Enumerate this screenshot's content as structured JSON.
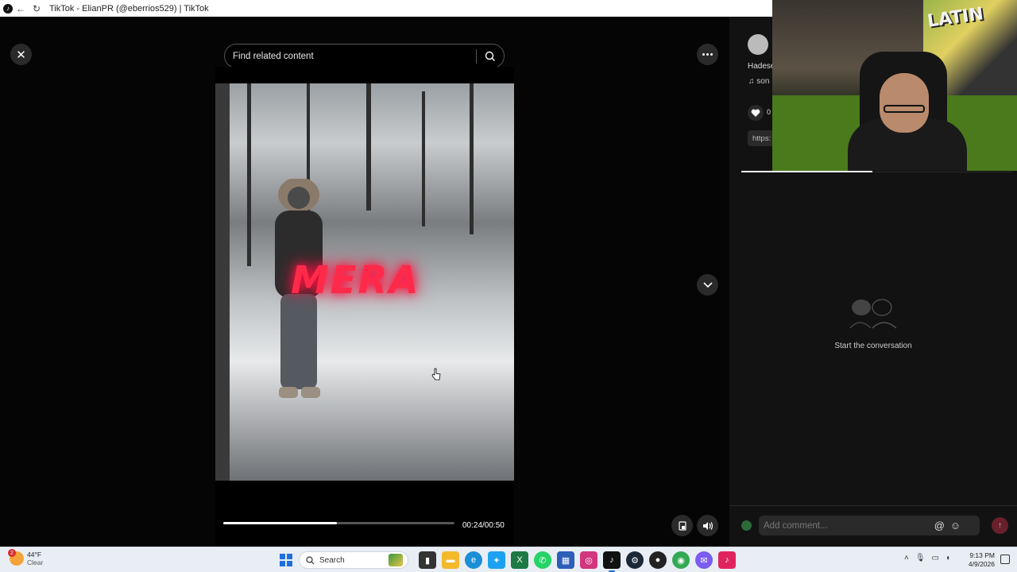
{
  "window": {
    "title": "TikTok - ElianPR (@eberrios529) | TikTok"
  },
  "viewer": {
    "search_placeholder": "Find related content",
    "overlay_text": "MERA",
    "time_display": "00:24/00:50",
    "progress_fraction": 0.49
  },
  "sidebar": {
    "author_name": "Hadese",
    "music_label": "son",
    "like_count": "0",
    "link_text": "https:",
    "empty_comments": "Start the conversation",
    "comment_placeholder": "Add comment...",
    "at_symbol": "@"
  },
  "webcam": {
    "graffiti": "LATIN"
  },
  "taskbar": {
    "weather_temp": "44°F",
    "weather_desc": "Clear",
    "weather_badge": "2",
    "search_label": "Search",
    "time": "9:13 PM",
    "date": "4/9/2026",
    "apps": [
      "file-manager",
      "edge",
      "twitter",
      "excel",
      "whatsapp",
      "store",
      "instagram",
      "tiktok",
      "steam",
      "github",
      "chrome",
      "messenger",
      "tiktok-alt"
    ]
  },
  "colors": {
    "accent": "#fe2c55",
    "background": "#000000",
    "sidebar": "#121212"
  }
}
